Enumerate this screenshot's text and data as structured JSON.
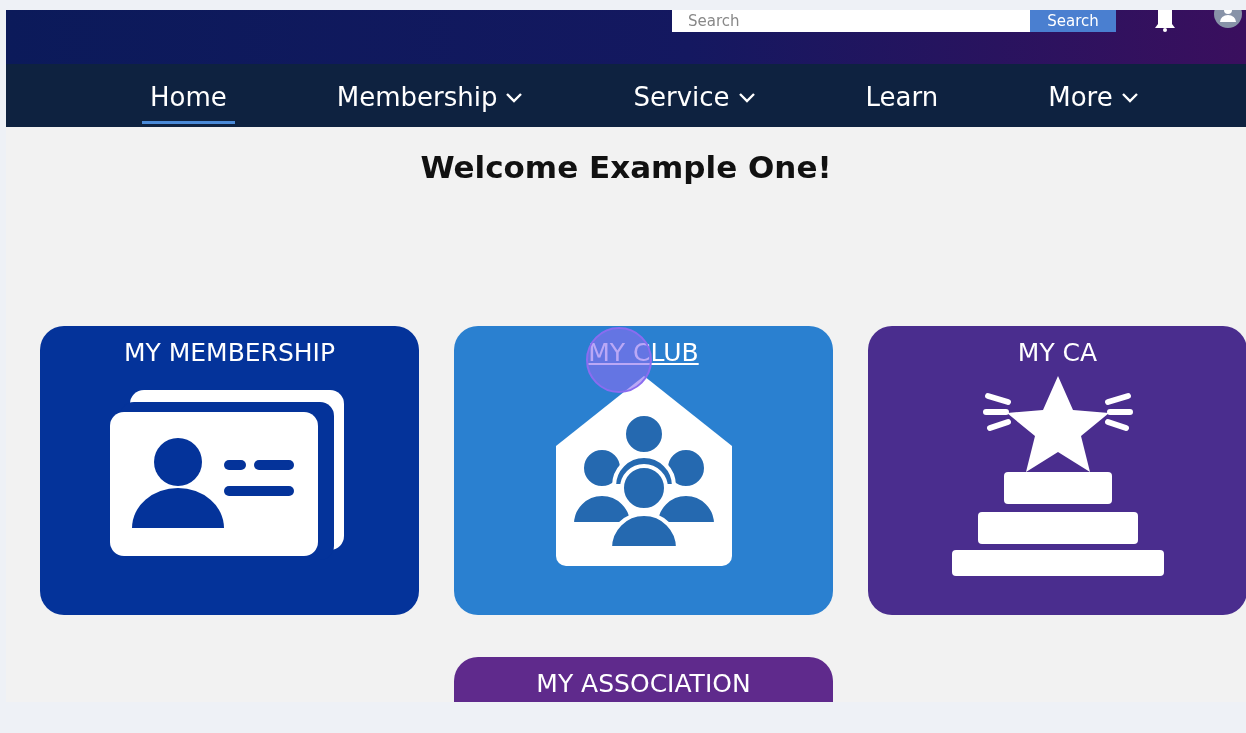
{
  "header": {
    "search": {
      "placeholder": "Search"
    },
    "search_button": "Search"
  },
  "nav": [
    {
      "label": "Home",
      "selected": true,
      "dropdown": false
    },
    {
      "label": "Membership",
      "selected": false,
      "dropdown": true
    },
    {
      "label": "Service",
      "selected": false,
      "dropdown": true
    },
    {
      "label": "Learn",
      "selected": false,
      "dropdown": false
    },
    {
      "label": "More",
      "selected": false,
      "dropdown": true
    }
  ],
  "welcome": "Welcome Example One!",
  "tiles": [
    {
      "title": "MY MEMBERSHIP",
      "kind": "card",
      "color": "#04339a",
      "underlined": false,
      "clicked": false
    },
    {
      "title": "MY CLUB",
      "kind": "club",
      "color": "#2a80d0",
      "underlined": true,
      "clicked": true
    },
    {
      "title": "MY CA",
      "kind": "award",
      "color": "#4a2d8e",
      "underlined": false,
      "clicked": false
    },
    {
      "title": "MY ASSOCIATION",
      "kind": "none",
      "color": "#5f2a8c",
      "underlined": false,
      "clicked": false
    }
  ]
}
